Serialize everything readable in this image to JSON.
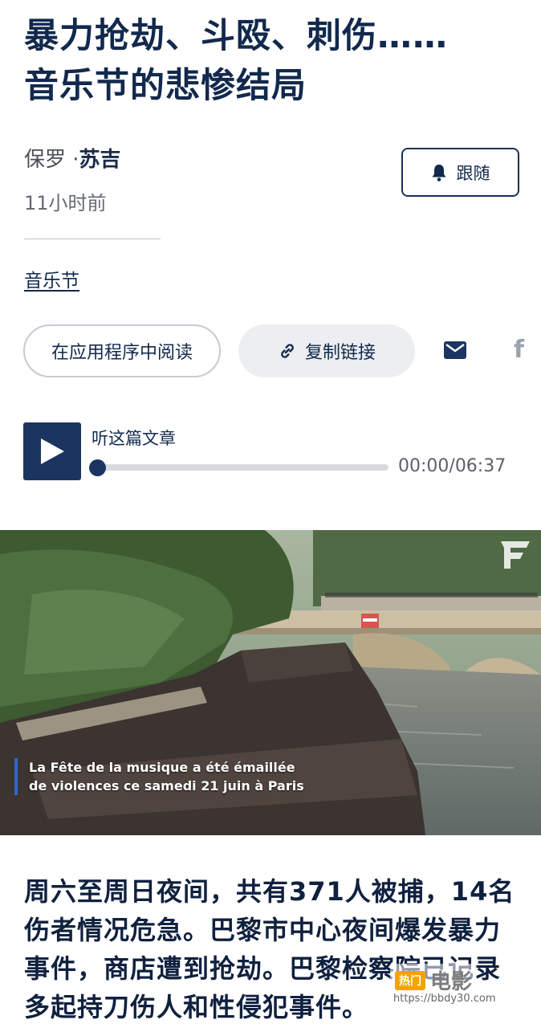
{
  "article": {
    "title_line1": "暴力抢劫、斗殴、刺伤……",
    "title_line2": "音乐节的悲惨结局",
    "author_prefix": "保罗 ·",
    "author_name": "苏吉",
    "time": "11小时前",
    "follow_label": "跟随",
    "tag": "音乐节"
  },
  "actions": {
    "read_in_app": "在应用程序中阅读",
    "copy_link": "复制链接",
    "icons": [
      "link-icon",
      "mail-icon",
      "facebook-icon"
    ]
  },
  "audio": {
    "label": "听这篇文章",
    "time": "00:00/06:37",
    "progress": 0
  },
  "photo": {
    "caption_line1": "La Fête de la musique a été émaillée",
    "caption_line2": "de violences ce samedi 21 juin à Paris",
    "logo": "F"
  },
  "body": {
    "paragraph": "周六至周日夜间，共有371人被捕，14名伤者情况危急。巴黎市中心夜间爆发暴力事件，商店遭到抢劫。巴黎检察院已记录多起持刀伤人和性侵犯事件。"
  },
  "watermark": {
    "badge": "热门",
    "text": "电影",
    "url": "https://bbdy30.com"
  },
  "colors": {
    "navy": "#12294d",
    "play_bg": "#1b3560",
    "caption_bar": "#2f66c8"
  }
}
